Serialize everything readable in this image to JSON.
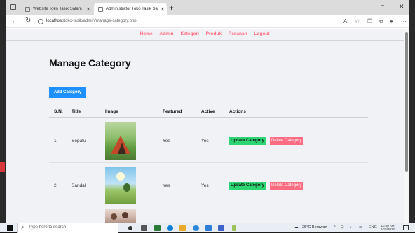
{
  "browser": {
    "tabs": [
      {
        "title": "Website Toko Tasik Salam"
      },
      {
        "title": "Administrator Toko Tasik Salam"
      }
    ],
    "new_tab": "+",
    "address": {
      "host": "localhost",
      "path": "/toko-tasik/admin/manage-category.php"
    }
  },
  "nav": {
    "items": [
      "Home",
      "Admin",
      "Kategori",
      "Produk",
      "Pesanan",
      "Logout"
    ]
  },
  "page": {
    "title": "Manage Category",
    "add_button": "Add Category"
  },
  "table": {
    "headers": [
      "S.N.",
      "Title",
      "Image",
      "Featured",
      "Active",
      "Actions"
    ],
    "rows": [
      {
        "sn": "1.",
        "title": "Sepatu",
        "featured": "Yes",
        "active": "Yes",
        "update": "Update Category",
        "delete": "Delete Category"
      },
      {
        "sn": "2.",
        "title": "Sandal",
        "featured": "Yes",
        "active": "Yes",
        "update": "Update Category",
        "delete": "Delete Category"
      }
    ]
  },
  "taskbar": {
    "search_placeholder": "Type here to search",
    "weather": "25°C  Berawan",
    "lang": "ENG",
    "time": "10:00 AM",
    "date": "6/15/2022"
  },
  "colors": {
    "accent_blue": "#1e90ff",
    "nav_pink": "#ff6b81",
    "update_green": "#2ed573",
    "delete_pink": "#ff6b81"
  }
}
